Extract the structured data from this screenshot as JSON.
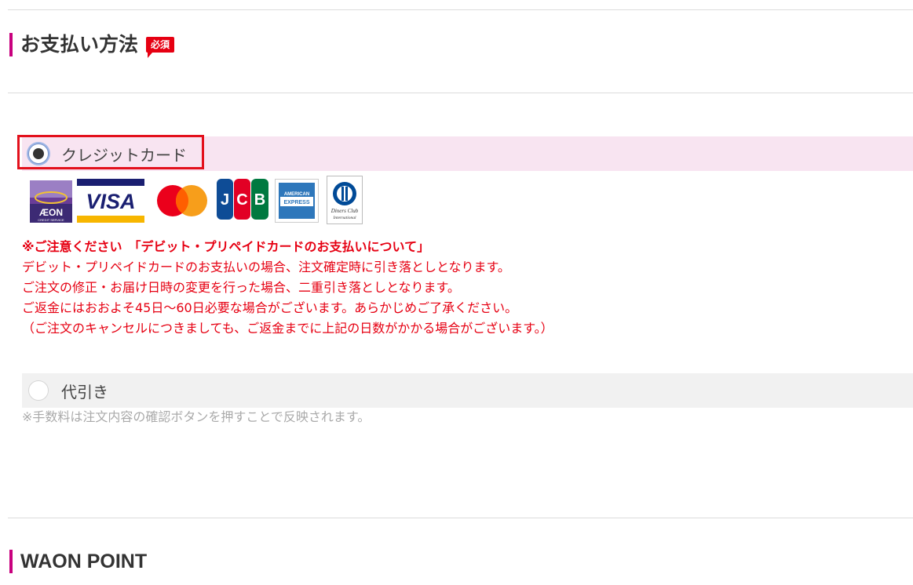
{
  "payment_section": {
    "title": "お支払い方法",
    "required_badge": "必須",
    "options": [
      {
        "label": "クレジットカード",
        "selected": true
      },
      {
        "label": "代引き",
        "selected": false
      }
    ],
    "card_brands": [
      "AEON",
      "VISA",
      "Mastercard",
      "JCB",
      "American Express",
      "Diners Club International"
    ],
    "notice": {
      "heading": "※ご注意ください　「デビット・プリペイドカードのお支払いについて」",
      "lines": [
        "デビット・プリペイドカードのお支払いの場合、注文確定時に引き落としとなります。",
        "ご注文の修正・お届け日時の変更を行った場合、二重引き落としとなります。",
        "ご返金にはおおよそ45日〜60日必要な場合がございます。あらかじめご了承ください。",
        "（ご注文のキャンセルにつきましても、ご返金までに上記の日数がかかる場合がございます。）"
      ]
    },
    "cod_note": "※手数料は注文内容の確認ボタンを押すことで反映されます。"
  },
  "waon_section": {
    "title": "WAON POINT"
  },
  "colors": {
    "accent": "#c8007e",
    "required": "#e60012",
    "selected_row_bg": "#f8e4f1",
    "unselected_row_bg": "#f1f1f1",
    "highlight_border": "#e3101c",
    "notice_text": "#e60012"
  }
}
